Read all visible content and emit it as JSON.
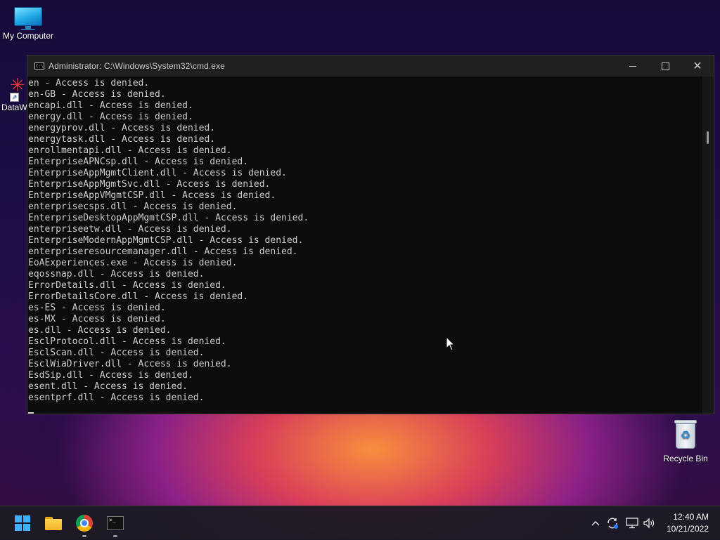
{
  "desktop": {
    "icons": [
      {
        "label": "My Computer",
        "icon": "monitor-icon"
      },
      {
        "label": "DataW",
        "icon": "datawrapper-shortcut-icon"
      },
      {
        "label": "Recycle Bin",
        "icon": "recycle-bin-icon"
      }
    ]
  },
  "window": {
    "title": "Administrator:  C:\\Windows\\System32\\cmd.exe",
    "app_icon_text": "C:\\",
    "controls": {
      "minimize": "—",
      "maximize": "☐",
      "close": "✕"
    },
    "lines": [
      "en - Access is denied.",
      "en-GB - Access is denied.",
      "encapi.dll - Access is denied.",
      "energy.dll - Access is denied.",
      "energyprov.dll - Access is denied.",
      "energytask.dll - Access is denied.",
      "enrollmentapi.dll - Access is denied.",
      "EnterpriseAPNCsp.dll - Access is denied.",
      "EnterpriseAppMgmtClient.dll - Access is denied.",
      "EnterpriseAppMgmtSvc.dll - Access is denied.",
      "EnterpriseAppVMgmtCSP.dll - Access is denied.",
      "enterprisecsps.dll - Access is denied.",
      "EnterpriseDesktopAppMgmtCSP.dll - Access is denied.",
      "enterpriseetw.dll - Access is denied.",
      "EnterpriseModernAppMgmtCSP.dll - Access is denied.",
      "enterpriseresourcemanager.dll - Access is denied.",
      "EoAExperiences.exe - Access is denied.",
      "eqossnap.dll - Access is denied.",
      "ErrorDetails.dll - Access is denied.",
      "ErrorDetailsCore.dll - Access is denied.",
      "es-ES - Access is denied.",
      "es-MX - Access is denied.",
      "es.dll - Access is denied.",
      "EsclProtocol.dll - Access is denied.",
      "EsclScan.dll - Access is denied.",
      "EsclWiaDriver.dll - Access is denied.",
      "EsdSip.dll - Access is denied.",
      "esent.dll - Access is denied.",
      "esentprf.dll - Access is denied."
    ]
  },
  "taskbar": {
    "apps": [
      {
        "name": "start-button",
        "icon": "windows-logo-icon"
      },
      {
        "name": "file-explorer",
        "icon": "folder-icon"
      },
      {
        "name": "chrome",
        "icon": "chrome-icon"
      },
      {
        "name": "command-prompt",
        "icon": "terminal-icon"
      }
    ],
    "tray": {
      "chevron": "^",
      "clock_time": "12:40 AM",
      "clock_date": "10/21/2022"
    }
  },
  "colors": {
    "console_bg": "#0c0c0c",
    "console_fg": "#cccccc",
    "titlebar_bg": "#202020",
    "windows_blue": "#3fb1ff"
  }
}
